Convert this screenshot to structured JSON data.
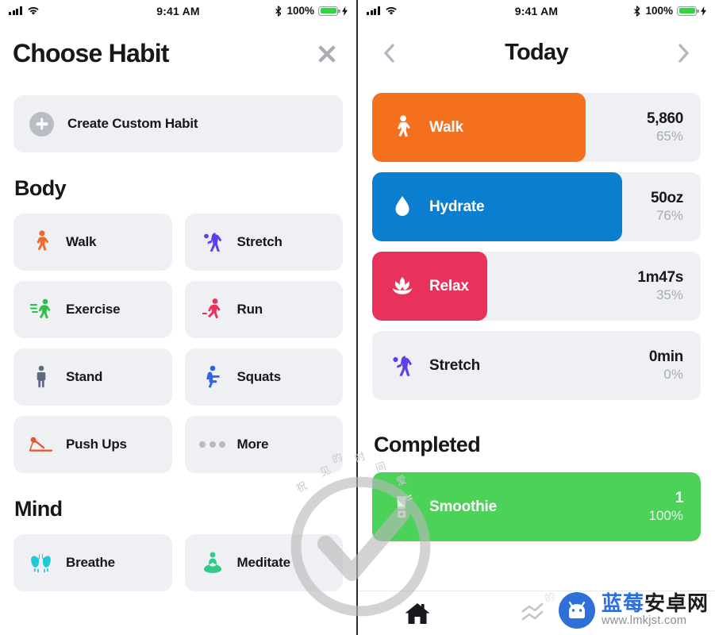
{
  "status_bar": {
    "time": "9:41 AM",
    "battery_percent": "100%",
    "signal_icon": "cellular-bars-icon",
    "wifi_icon": "wifi-icon",
    "bluetooth_icon": "bluetooth-icon",
    "battery_icon": "battery-full-icon",
    "charging_icon": "charging-bolt-icon"
  },
  "left_screen": {
    "title": "Choose Habit",
    "close_icon": "close-icon",
    "create_custom": {
      "label": "Create Custom Habit",
      "icon": "plus-circle-icon"
    },
    "sections": [
      {
        "title": "Body",
        "habits": [
          {
            "label": "Walk",
            "icon": "walking-person-icon",
            "color": "#f2692a"
          },
          {
            "label": "Stretch",
            "icon": "stretching-person-icon",
            "color": "#5b3ff0"
          },
          {
            "label": "Exercise",
            "icon": "running-fast-icon",
            "color": "#2fc04a"
          },
          {
            "label": "Run",
            "icon": "runner-icon",
            "color": "#e8315b"
          },
          {
            "label": "Stand",
            "icon": "standing-person-icon",
            "color": "#5d6b80"
          },
          {
            "label": "Squats",
            "icon": "squatting-person-icon",
            "color": "#2f62e8"
          },
          {
            "label": "Push Ups",
            "icon": "pushup-person-icon",
            "color": "#e8512a"
          },
          {
            "label": "More",
            "icon": "more-dots-icon",
            "color": "#b7bac2"
          }
        ]
      },
      {
        "title": "Mind",
        "habits": [
          {
            "label": "Breathe",
            "icon": "lungs-icon",
            "color": "#1fc8d4"
          },
          {
            "label": "Meditate",
            "icon": "meditating-person-icon",
            "color": "#2fc98a"
          }
        ]
      }
    ]
  },
  "right_screen": {
    "title": "Today",
    "prev_icon": "chevron-left-icon",
    "next_icon": "chevron-right-icon",
    "active_habits": [
      {
        "label": "Walk",
        "value": "5,860",
        "percent": "65%",
        "fill": 65,
        "color": "#f4701f",
        "icon": "walking-person-icon"
      },
      {
        "label": "Hydrate",
        "value": "50oz",
        "percent": "76%",
        "fill": 76,
        "color": "#0c7ecf",
        "icon": "water-drop-icon"
      },
      {
        "label": "Relax",
        "value": "1m47s",
        "percent": "35%",
        "fill": 35,
        "color": "#e8315b",
        "icon": "lotus-flower-icon"
      },
      {
        "label": "Stretch",
        "value": "0min",
        "percent": "0%",
        "fill": 0,
        "color": "#5b3ff0",
        "icon": "stretching-person-icon"
      }
    ],
    "completed_title": "Completed",
    "completed_habits": [
      {
        "label": "Smoothie",
        "value": "1",
        "percent": "100%",
        "fill": 100,
        "color": "#4cd159",
        "icon": "blender-icon"
      }
    ],
    "tabs": [
      {
        "name": "home",
        "icon": "home-icon",
        "active": true
      },
      {
        "name": "trends",
        "icon": "trends-chart-icon",
        "active": false
      }
    ]
  },
  "watermark": {
    "check_icon": "check-circle-watermark-icon",
    "brand_cn_blue": "蓝莓",
    "brand_cn_black": "安卓网",
    "url": "www.lmkjst.com",
    "logo_icon": "android-mascot-icon",
    "scattered": [
      "祝",
      "见",
      "的",
      "时",
      "间",
      "爱"
    ]
  },
  "colors": {
    "card_bg": "#eff0f4",
    "text": "#17181c",
    "muted": "#a8abb4"
  }
}
